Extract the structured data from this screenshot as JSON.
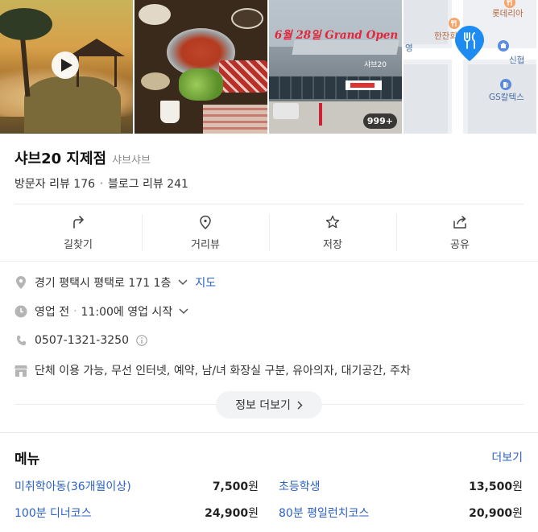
{
  "gallery": {
    "photo3_overlay_text": "6월 28일 Grand Open",
    "photo3_sign_text": "샤브20",
    "photo_count_badge": "999+",
    "map_labels": {
      "lotteria": "롯데리아",
      "hanjanhoe": "한잔회",
      "sinhyeon": "신협",
      "gs_caltex": "GS칼텍스",
      "road_glyph": "영"
    }
  },
  "place": {
    "name": "샤브20 지제점",
    "category": "샤브샤브",
    "visitor_reviews": "방문자 리뷰 176",
    "blog_reviews": "블로그 리뷰 241"
  },
  "actions": [
    {
      "label": "길찾기",
      "icon": "directions-icon"
    },
    {
      "label": "거리뷰",
      "icon": "location-pin-icon"
    },
    {
      "label": "저장",
      "icon": "star-icon"
    },
    {
      "label": "공유",
      "icon": "share-icon"
    }
  ],
  "info": {
    "address": "경기 평택시 평택로 171 1층",
    "map_link": "지도",
    "status": "영업 전",
    "hours": "11:00에 영업 시작",
    "phone": "0507-1321-3250",
    "amenities": "단체 이용 가능, 무선 인터넷, 예약, 남/녀 화장실 구분, 유아의자, 대기공간, 주차",
    "more_info_button": "정보 더보기"
  },
  "menu": {
    "title": "메뉴",
    "more_link": "더보기",
    "items": [
      {
        "name": "미취학아동(36개월이상)",
        "price": "7,500",
        "unit": "원"
      },
      {
        "name": "초등학생",
        "price": "13,500",
        "unit": "원"
      },
      {
        "name": "100분 디너코스",
        "price": "24,900",
        "unit": "원"
      },
      {
        "name": "80분 평일런치코스",
        "price": "20,900",
        "unit": "원"
      }
    ]
  },
  "colors": {
    "link_blue": "#2b62c6",
    "map_pin_blue": "#1e8bf0",
    "overlay_red": "#e3263b"
  }
}
